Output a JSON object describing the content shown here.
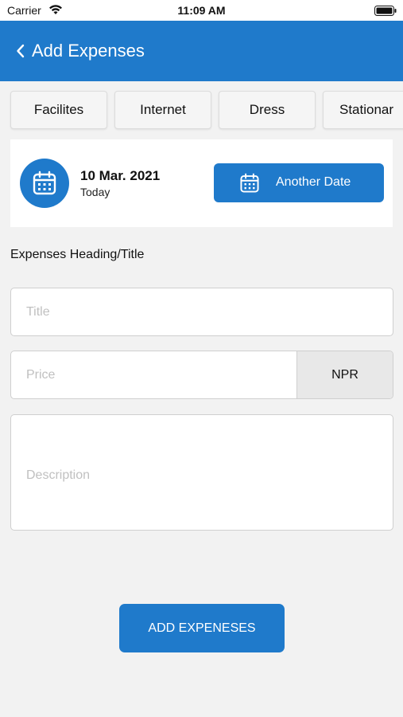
{
  "status_bar": {
    "carrier": "Carrier",
    "time": "11:09 AM",
    "icons": [
      "wifi-icon",
      "battery-icon"
    ]
  },
  "header": {
    "title": "Add Expenses",
    "back_icon": "chevron-left-icon",
    "background_color": "#1f7acb"
  },
  "categories": [
    {
      "label": "Facilites"
    },
    {
      "label": "Internet"
    },
    {
      "label": "Dress"
    },
    {
      "label": "Stationar"
    }
  ],
  "date_card": {
    "date": "10 Mar. 2021",
    "relative": "Today",
    "icon": "calendar-icon",
    "another_date_label": "Another Date"
  },
  "form": {
    "section_label": "Expenses Heading/Title",
    "title_placeholder": "Title",
    "price_placeholder": "Price",
    "currency": "NPR",
    "description_placeholder": "Description",
    "submit_label": "ADD EXPENESES"
  },
  "colors": {
    "accent": "#1f7acb",
    "background": "#f2f2f2"
  }
}
